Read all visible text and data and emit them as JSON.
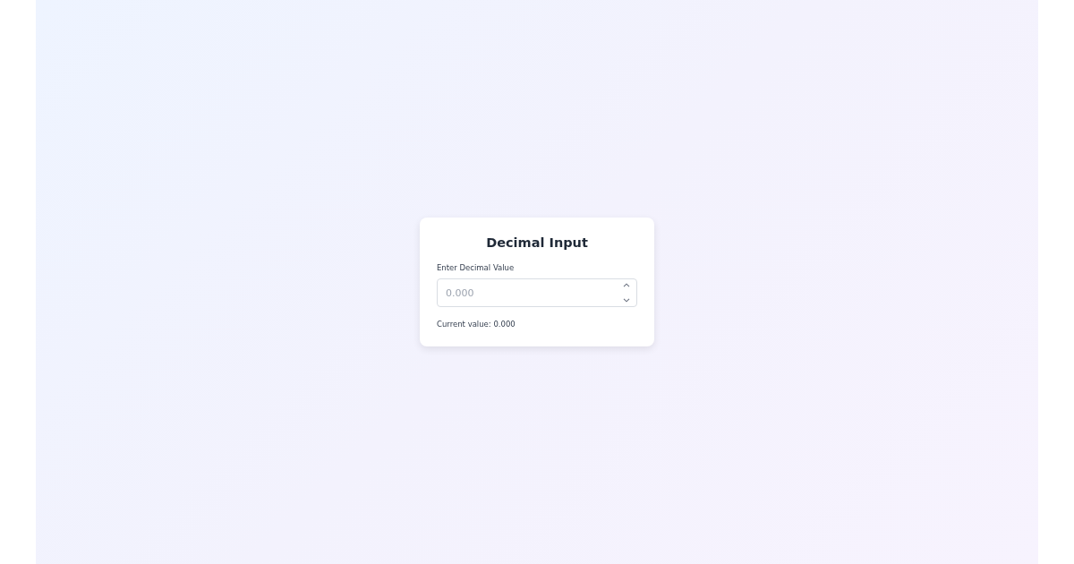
{
  "card": {
    "title": "Decimal Input",
    "field": {
      "label": "Enter Decimal Value",
      "placeholder": "0.000"
    },
    "current_value": "Current value: 0.000"
  }
}
